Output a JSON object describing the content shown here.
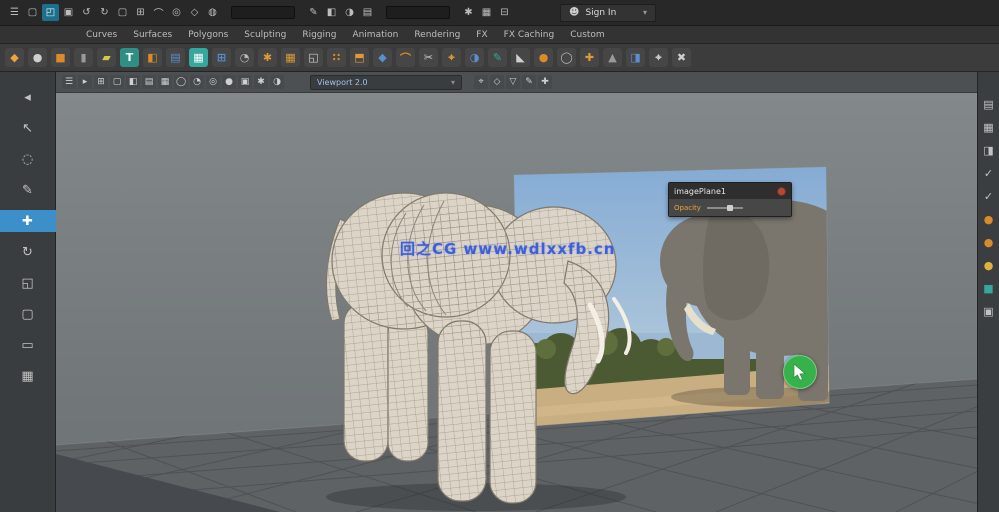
{
  "colors": {
    "accent_blue": "#3d8fc9",
    "shelf_orange": "#d98a2b",
    "teal": "#35a79c",
    "viewport_bg": "#777c7f",
    "ground_grid": "#5e6265",
    "watermark_blue": "#2d52d6",
    "click_green": "#35b24a"
  },
  "statusline": {
    "icons": [
      {
        "name": "menu-toggle-icon",
        "glyph": "☰"
      },
      {
        "name": "new-scene-icon",
        "glyph": "▢"
      },
      {
        "name": "open-scene-icon",
        "glyph": "◰",
        "active": true
      },
      {
        "name": "save-scene-icon",
        "glyph": "▣"
      },
      {
        "name": "undo-icon",
        "glyph": "↺"
      },
      {
        "name": "redo-icon",
        "glyph": "↻"
      },
      {
        "name": "selection-mask-icon",
        "glyph": "▢"
      },
      {
        "name": "snap-grid-icon",
        "glyph": "⊞"
      },
      {
        "name": "snap-curve-icon",
        "glyph": "⌒"
      },
      {
        "name": "snap-point-icon",
        "glyph": "◎"
      },
      {
        "name": "snap-plane-icon",
        "glyph": "◇"
      },
      {
        "name": "make-live-icon",
        "glyph": "◍"
      }
    ],
    "icons2": [
      {
        "name": "construction-history-icon",
        "glyph": "✎"
      },
      {
        "name": "render-icon",
        "glyph": "◧"
      },
      {
        "name": "ipr-render-icon",
        "glyph": "◑"
      },
      {
        "name": "render-settings-icon",
        "glyph": "▤"
      }
    ],
    "icons3": [
      {
        "name": "paint-effects-icon",
        "glyph": "✱"
      },
      {
        "name": "hypershade-icon",
        "glyph": "▦"
      },
      {
        "name": "toolbox-icon",
        "glyph": "⊟"
      }
    ],
    "signin_label": "Sign In"
  },
  "shelf_tabs": [
    "Curves",
    "Surfaces",
    "Polygons",
    "Sculpting",
    "Rigging",
    "Animation",
    "Rendering",
    "FX",
    "FX Caching",
    "Custom"
  ],
  "shelf_icons": [
    {
      "name": "curve-tool-icon",
      "glyph": "◆",
      "fg": "#f0a43c"
    },
    {
      "name": "sphere-icon",
      "glyph": "●",
      "fg": "#cfcfcf"
    },
    {
      "name": "cube-icon",
      "glyph": "■",
      "fg": "#d98a2b"
    },
    {
      "name": "cylinder-icon",
      "glyph": "▮",
      "fg": "#9a9a9a"
    },
    {
      "name": "plane-icon",
      "glyph": "▰",
      "fg": "#d8c84a"
    },
    {
      "name": "type-tool-icon",
      "glyph": "T",
      "fg": "#ffffff",
      "bg": "#2f8f85"
    },
    {
      "name": "boolean-icon",
      "glyph": "◧",
      "fg": "#d98a2b"
    },
    {
      "name": "mash-icon",
      "glyph": "▤",
      "fg": "#5a8fd0"
    },
    {
      "name": "remesh-icon",
      "glyph": "▦",
      "fg": "#ffffff",
      "bg": "#35a79c"
    },
    {
      "name": "grid-icon",
      "glyph": "⊞",
      "fg": "#5a8fd0"
    },
    {
      "name": "smooth-icon",
      "glyph": "◔",
      "fg": "#b8b8b8"
    },
    {
      "name": "star-icon",
      "glyph": "✱",
      "fg": "#e09a33"
    },
    {
      "name": "lattice-icon",
      "glyph": "▦",
      "fg": "#e09a33"
    },
    {
      "name": "combine-icon",
      "glyph": "◱",
      "fg": "#cfcfcf"
    },
    {
      "name": "separate-icon",
      "glyph": "∷",
      "fg": "#d98a2b"
    },
    {
      "name": "extrude-icon",
      "glyph": "⬒",
      "fg": "#e09a33"
    },
    {
      "name": "bevel-icon",
      "glyph": "◆",
      "fg": "#5a8fd0"
    },
    {
      "name": "bridge-icon",
      "glyph": "⌒",
      "fg": "#d98a2b"
    },
    {
      "name": "multicut-icon",
      "glyph": "✂",
      "fg": "#cfcfcf"
    },
    {
      "name": "target-weld-icon",
      "glyph": "⌖",
      "fg": "#e09a33"
    },
    {
      "name": "mirror-icon",
      "glyph": "◑",
      "fg": "#5a8fd0"
    },
    {
      "name": "quad-draw-icon",
      "glyph": "✎",
      "fg": "#35a79c"
    },
    {
      "name": "crease-icon",
      "glyph": "◣",
      "fg": "#cfcfcf"
    },
    {
      "name": "sculpt-icon",
      "glyph": "●",
      "fg": "#d98a2b"
    },
    {
      "name": "relax-icon",
      "glyph": "◯",
      "fg": "#b8b8b8"
    },
    {
      "name": "pin-icon",
      "glyph": "✚",
      "fg": "#e09a33"
    },
    {
      "name": "wedge-icon",
      "glyph": "▲",
      "fg": "#9a9a9a"
    },
    {
      "name": "symmetry-icon",
      "glyph": "◨",
      "fg": "#5a8fd0"
    },
    {
      "name": "measure-icon",
      "glyph": "⌖",
      "fg": "#cfcfcf"
    },
    {
      "name": "delete-icon",
      "glyph": "✖",
      "fg": "#cfcfcf"
    }
  ],
  "panelbar": {
    "renderer_label": "Viewport 2.0",
    "icons": [
      {
        "name": "panel-menu-icon",
        "glyph": "☰"
      },
      {
        "name": "select-camera-icon",
        "glyph": "▸"
      },
      {
        "name": "grid-toggle-icon",
        "glyph": "⊞"
      },
      {
        "name": "film-gate-icon",
        "glyph": "▢"
      },
      {
        "name": "resolution-gate-icon",
        "glyph": "◧"
      },
      {
        "name": "gate-mask-icon",
        "glyph": "▤"
      },
      {
        "name": "field-chart-icon",
        "glyph": "▦"
      },
      {
        "name": "safe-action-icon",
        "glyph": "◯"
      },
      {
        "name": "safe-title-icon",
        "glyph": "◔"
      },
      {
        "name": "wireframe-icon",
        "glyph": "◎"
      },
      {
        "name": "shaded-icon",
        "glyph": "●"
      },
      {
        "name": "textured-icon",
        "glyph": "▣"
      },
      {
        "name": "lighting-icon",
        "glyph": "✱"
      },
      {
        "name": "shadows-icon",
        "glyph": "◑"
      }
    ],
    "right_icons": [
      {
        "name": "isolate-select-icon",
        "glyph": "⌖"
      },
      {
        "name": "xray-icon",
        "glyph": "◇"
      },
      {
        "name": "exposure-icon",
        "glyph": "▽"
      },
      {
        "name": "gamma-icon",
        "glyph": "✎"
      },
      {
        "name": "snapshot-icon",
        "glyph": "✚"
      }
    ]
  },
  "toolbox": {
    "icons": [
      {
        "name": "collapse-arrow-icon",
        "glyph": "◂"
      },
      {
        "name": "select-tool-icon",
        "glyph": "↖"
      },
      {
        "name": "lasso-tool-icon",
        "glyph": "◌"
      },
      {
        "name": "paint-select-tool-icon",
        "glyph": "✎"
      },
      {
        "name": "move-tool-icon",
        "glyph": "✚",
        "active": true
      },
      {
        "name": "rotate-tool-icon",
        "glyph": "↻"
      },
      {
        "name": "scale-tool-icon",
        "glyph": "◱"
      },
      {
        "name": "last-tool-icon",
        "glyph": "▢"
      },
      {
        "name": "layout-single-pane-icon",
        "glyph": "▭"
      },
      {
        "name": "layout-four-pane-icon",
        "glyph": "▦"
      }
    ]
  },
  "right_panel": {
    "icons": [
      {
        "name": "channel-box-icon",
        "glyph": "▤"
      },
      {
        "name": "layer-editor-icon",
        "glyph": "▦"
      },
      {
        "name": "display-toggle-icon",
        "glyph": "◨"
      },
      {
        "name": "visibility-check-icon",
        "glyph": "✓"
      },
      {
        "name": "render-check-icon",
        "glyph": "✓"
      },
      {
        "name": "material-sphere-icon",
        "glyph": "●",
        "fg": "#d98a2b"
      },
      {
        "name": "material-sphere-icon-2",
        "glyph": "●",
        "fg": "#d98a2b"
      },
      {
        "name": "material-sphere-icon-3",
        "glyph": "●",
        "fg": "#e0b13f"
      },
      {
        "name": "utility-icon",
        "glyph": "■",
        "fg": "#35a79c"
      },
      {
        "name": "texture-icon",
        "glyph": "▣"
      }
    ]
  },
  "viewport": {
    "watermark": "回之CG  www.wdlxxfb.cn",
    "popup": {
      "title": "imagePlane1",
      "row_label": "Opacity"
    }
  }
}
